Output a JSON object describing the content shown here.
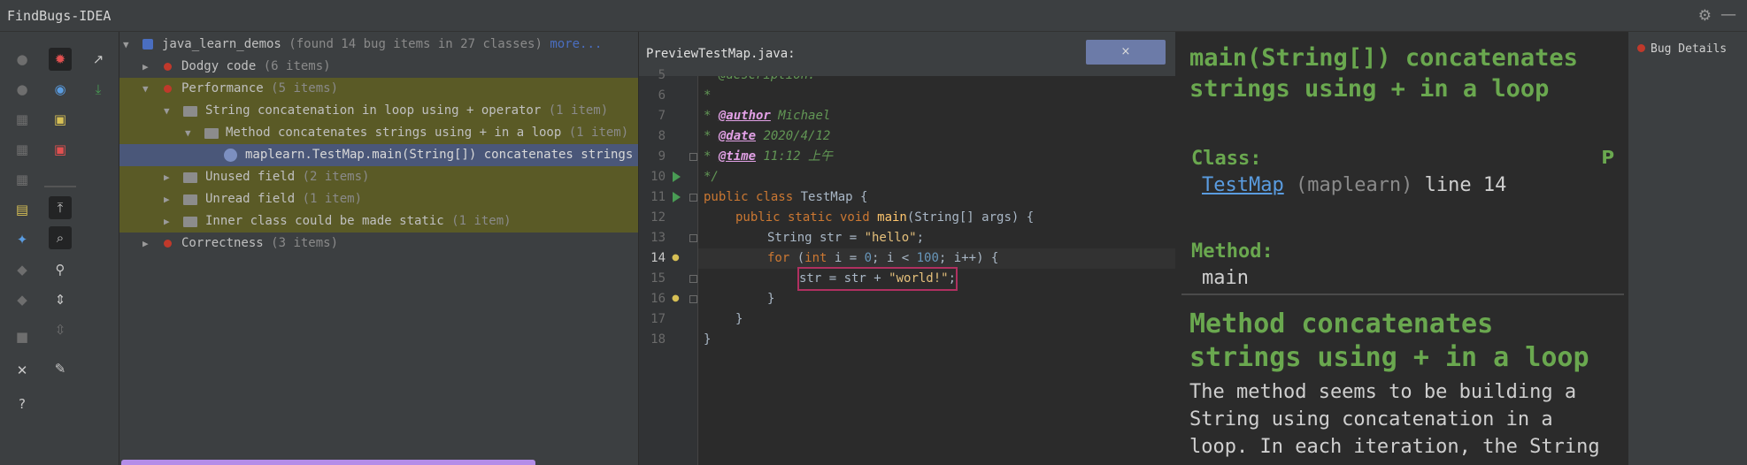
{
  "window": {
    "title": "FindBugs-IDEA"
  },
  "tree": {
    "root": {
      "label": "java_learn_demos",
      "count": "(found 14 bug items in 27 classes)",
      "more": "more..."
    },
    "items": [
      {
        "label": "Dodgy code",
        "count": "(6 items)"
      },
      {
        "label": "Performance",
        "count": "(5 items)"
      },
      {
        "label": "String concatenation in loop using + operator",
        "count": "(1 item)"
      },
      {
        "label": "Method concatenates strings using + in a loop",
        "count": "(1 item)"
      },
      {
        "label": "maplearn.TestMap.main(String[]) concatenates strings us",
        "count": ""
      },
      {
        "label": "Unused field",
        "count": "(2 items)"
      },
      {
        "label": "Unread field",
        "count": "(1 item)"
      },
      {
        "label": "Inner class could be made static",
        "count": "(1 item)"
      },
      {
        "label": "Correctness",
        "count": "(3 items)"
      }
    ]
  },
  "editor": {
    "file_label": "PreviewTestMap.java:",
    "close_label": "×",
    "lines": [
      "5",
      "6",
      "7",
      "8",
      "9",
      "10",
      "11",
      "12",
      "13",
      "14",
      "15",
      "16",
      "17",
      "18"
    ],
    "code": {
      "l5": "* @description:",
      "l6": "*",
      "l7_tag": "@author",
      "l7_val": " Michael",
      "l8_tag": "@date",
      "l8_val": " 2020/4/12",
      "l9_tag": "@time",
      "l9_val": " 11:12 上午",
      "l10": "*/",
      "l11_kw": "public class",
      "l11_name": " TestMap {",
      "l12_kw": "public static void",
      "l12_fn": " main",
      "l12_rest": "(String[] args) {",
      "l13_type": "String str = ",
      "l13_str": "\"hello\"",
      "l13_end": ";",
      "l14_kw": "for",
      "l14_p1": " (",
      "l14_kw2": "int",
      "l14_p2": " i = ",
      "l14_n0": "0",
      "l14_p3": "; i < ",
      "l14_n1": "100",
      "l14_p4": "; i++) {",
      "l15_a": "str = str + ",
      "l15_str": "\"world!\"",
      "l15_end": ";",
      "l16": "}",
      "l17": "}",
      "l18": "}"
    }
  },
  "details": {
    "heading": "main(String[]) concatenates strings using + in a loop",
    "class_label": "Class:",
    "priority": "P",
    "class_name": "TestMap",
    "class_pkg": "(maplearn)",
    "class_line": "line 14",
    "method_label": "Method:",
    "method_value": "main",
    "pattern_heading": "Method concatenates strings using + in a loop",
    "description": "The method seems to be building a String using concatenation in a loop. In each iteration, the String is converted to"
  },
  "right_tab": {
    "label": "Bug Details"
  },
  "colors": {
    "accent_green": "#6aa84f",
    "highlight_row": "#5a5a26",
    "selection": "#4a5779",
    "link": "#5a9ce0"
  }
}
